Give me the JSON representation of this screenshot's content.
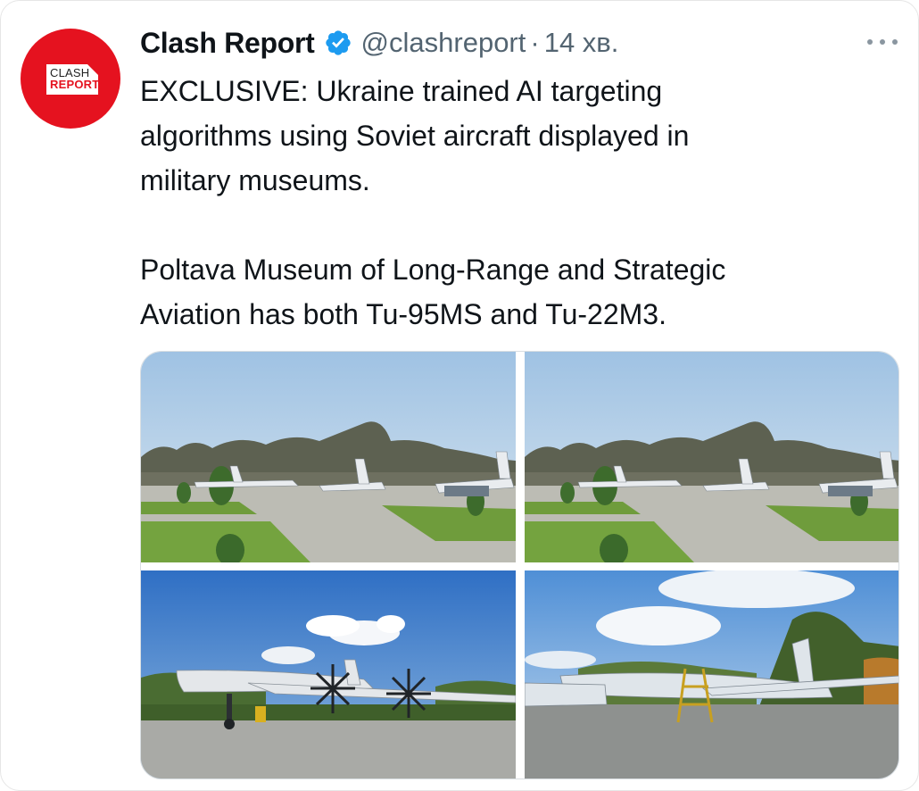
{
  "author": {
    "display_name": "Clash Report",
    "handle": "@clashreport",
    "separator": "·",
    "timestamp": "14 хв.",
    "verified": true,
    "avatar_logo_top": "CLASH",
    "avatar_logo_bottom": "REPORT",
    "brand_color": "#e5121f",
    "verified_color": "#1d9bf0"
  },
  "tweet": {
    "text": "EXCLUSIVE: Ukraine trained AI targeting\nalgorithms using Soviet aircraft displayed in\nmilitary museums.\n\nPoltava Museum of Long-Range and Strategic\nAviation has both Tu-95MS and Tu-22M3."
  },
  "media": {
    "photos": [
      {
        "icon": "photo-aircraft-row-icon"
      },
      {
        "icon": "photo-aircraft-row-icon"
      },
      {
        "icon": "photo-tu95-icon"
      },
      {
        "icon": "photo-tu22-icon"
      }
    ]
  },
  "icons": {
    "more": "more-options-icon",
    "verified": "verified-badge-icon"
  }
}
